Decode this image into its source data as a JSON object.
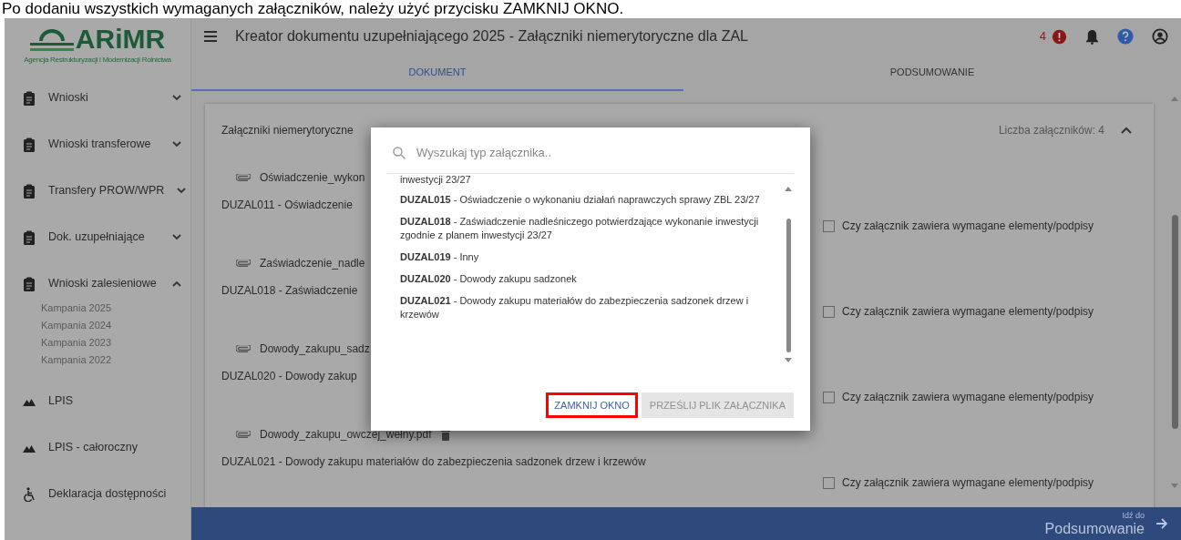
{
  "caption": "Po dodaniu wszystkich wymaganych załączników, należy użyć przycisku ZAMKNIJ OKNO.",
  "logo": {
    "name": "ARiMR",
    "subtitle": "Agencja Restrukturyzacji i Modernizacji Rolnictwa"
  },
  "header": {
    "title": "Kreator dokumentu uzupełniającego 2025 - Załączniki niemerytoryczne dla ZAL",
    "error_count": "4"
  },
  "tabs": [
    {
      "label": "DOKUMENT",
      "selected": true
    },
    {
      "label": "PODSUMOWANIE",
      "selected": false
    }
  ],
  "sidebar": {
    "items": [
      {
        "label": "Wnioski",
        "kind": "clipboard",
        "expanded": false
      },
      {
        "label": "Wnioski transferowe",
        "kind": "clipboard",
        "expanded": false
      },
      {
        "label": "Transfery PROW/WPR",
        "kind": "clipboard",
        "expanded": false
      },
      {
        "label": "Dok. uzupełniające",
        "kind": "clipboard",
        "expanded": false
      },
      {
        "label": "Wnioski zalesieniowe",
        "kind": "clipboard",
        "expanded": true,
        "children": [
          "Kampania 2025",
          "Kampania 2024",
          "Kampania 2023",
          "Kampania 2022"
        ]
      },
      {
        "label": "LPIS",
        "kind": "mountains"
      },
      {
        "label": "LPIS - całoroczny",
        "kind": "mountains"
      },
      {
        "label": "Deklaracja dostępności",
        "kind": "accessibility"
      }
    ]
  },
  "section": {
    "title": "Załączniki niemerytoryczne",
    "count": "Liczba załączników: 4",
    "expanded": true,
    "attachments": [
      {
        "file": "Oświadczenie_wykon",
        "description": "DUZAL011 - Oświadczenie",
        "deletable": false,
        "check_label": "Czy załącznik zawiera wymagane elementy/podpisy",
        "checked": false
      },
      {
        "file": "Zaświadczenie_nadle",
        "description": "DUZAL018 - Zaświadczenie",
        "deletable": false,
        "check_label": "Czy załącznik zawiera wymagane elementy/podpisy",
        "checked": false
      },
      {
        "file": "Dowody_zakupu_sadz",
        "description": "DUZAL020 - Dowody zakup",
        "deletable": false,
        "check_label": "Czy załącznik zawiera wymagane elementy/podpisy",
        "checked": false
      },
      {
        "file": "Dowody_zakupu_owczej_wełny.pdf",
        "description": "DUZAL021 - Dowody zakupu materiałów do zabezpieczenia sadzonek drzew i krzewów",
        "deletable": true,
        "check_label": "Czy załącznik zawiera wymagane elementy/podpisy",
        "checked": false
      }
    ]
  },
  "footer": {
    "small": "Idź do",
    "label": "Podsumowanie"
  },
  "dialog": {
    "search_placeholder": "Wyszukaj typ załącznika..",
    "list_fragment": "inwestycji 23/27",
    "items": [
      {
        "text": "**DUZAL015** - Oświadczenie o wykonaniu działań naprawczych sprawy ZBL 23/27"
      },
      {
        "text": "**DUZAL018** - Zaświadczenie nadleśniczego potwierdzające wykonanie inwestycji zgodnie z planem inwestycji 23/27"
      },
      {
        "text": "**DUZAL019** - Inny"
      },
      {
        "text": "**DUZAL020** - Dowody zakupu sadzonek"
      },
      {
        "text": "**DUZAL021** - Dowody zakupu materiałów do zabezpieczenia sadzonek drzew i krzewów"
      }
    ],
    "buttons": [
      {
        "label": "ZAMKNIJ OKNO",
        "disabled": false,
        "highlighted": true
      },
      {
        "label": "PRZEŚLIJ PLIK ZAŁĄCZNIKA",
        "disabled": true,
        "highlighted": false
      }
    ]
  }
}
